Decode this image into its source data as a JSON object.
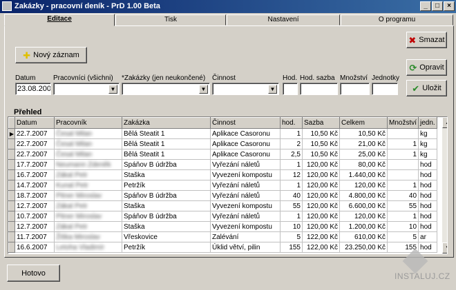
{
  "window": {
    "title": "Zakázky - pracovní deník - PrD 1.00 Beta",
    "min": "_",
    "max": "□",
    "close": "×"
  },
  "tabs": [
    {
      "label": "Editace",
      "active": true
    },
    {
      "label": "Tisk"
    },
    {
      "label": "Nastavení"
    },
    {
      "label": "O programu"
    }
  ],
  "toolbar": {
    "new_record": "Nový záznam",
    "delete": "Smazat",
    "edit": "Opravit",
    "save": "Uložit",
    "done": "Hotovo"
  },
  "form": {
    "datum_label": "Datum",
    "datum_value": "23.08.2007",
    "pracovnici_label": "Pracovníci (všichni)",
    "zakazky_label": "*Zakázky (jen neukončené)",
    "cinnost_label": "Činnost",
    "hod_label": "Hod.",
    "hod_sazba_label": "Hod. sazba",
    "mnozstvi_label": "Množství",
    "jednotky_label": "Jednotky"
  },
  "grid": {
    "title": "Přehled",
    "columns": [
      "Datum",
      "Pracovník",
      "Zakázka",
      "Činnost",
      "hod.",
      "Sazba",
      "Celkem",
      "Množství",
      "jedn."
    ],
    "rows": [
      [
        "22.7.2007",
        "Česal Milan",
        "Bělá Steatit 1",
        "Aplikace Casoronu",
        "1",
        "10,50 Kč",
        "10,50 Kč",
        "",
        "kg"
      ],
      [
        "22.7.2007",
        "Česal Milan",
        "Bělá Steatit 1",
        "Aplikace Casoronu",
        "2",
        "10,50 Kč",
        "21,00 Kč",
        "1",
        "kg"
      ],
      [
        "22.7.2007",
        "Česal Milan",
        "Bělá Steatit 1",
        "Aplikace Casoronu",
        "2,5",
        "10,50 Kč",
        "25,00 Kč",
        "1",
        "kg"
      ],
      [
        "17.7.2007",
        "Neumann Zdeněk",
        "Spáňov B údržba",
        "Vyřezání náletů",
        "1",
        "120,00 Kč",
        "80,00 Kč",
        "",
        "hod"
      ],
      [
        "16.7.2007",
        "Zákal Petr",
        "Staška",
        "Vyvezení kompostu",
        "12",
        "120,00 Kč",
        "1.440,00 Kč",
        "",
        "hod"
      ],
      [
        "14.7.2007",
        "Kunal Petr",
        "Petržík",
        "Vyřezání náletů",
        "1",
        "120,00 Kč",
        "120,00 Kč",
        "1",
        "hod"
      ],
      [
        "18.7.2007",
        "Pitner Miroslav",
        "Spáňov B údržba",
        "Vyřezání náletů",
        "40",
        "120,00 Kč",
        "4.800,00 Kč",
        "40",
        "hod"
      ],
      [
        "12.7.2007",
        "Zákal Petr",
        "Staška",
        "Vyvezení kompostu",
        "55",
        "120,00 Kč",
        "6.600,00 Kč",
        "55",
        "hod"
      ],
      [
        "10.7.2007",
        "Pitner Miroslav",
        "Spáňov B údržba",
        "Vyřezání náletů",
        "1",
        "120,00 Kč",
        "120,00 Kč",
        "1",
        "hod"
      ],
      [
        "12.7.2007",
        "Zákal Petr",
        "Staška",
        "Vyvezení kompostu",
        "10",
        "120,00 Kč",
        "1.200,00 Kč",
        "10",
        "hod"
      ],
      [
        "11.7.2007",
        "Žiška Miroslav",
        "Vřeskovice",
        "Zalévání",
        "5",
        "122,00 Kč",
        "610,00 Kč",
        "5",
        "ar"
      ],
      [
        "16.6.2007",
        "Letoha Vladimír",
        "Petržík",
        "Úklid větví, pilin",
        "155",
        "122,00 Kč",
        "23.250,00 Kč",
        "155",
        "hod"
      ]
    ]
  },
  "watermark": {
    "text": "INSTALUJ.CZ"
  }
}
